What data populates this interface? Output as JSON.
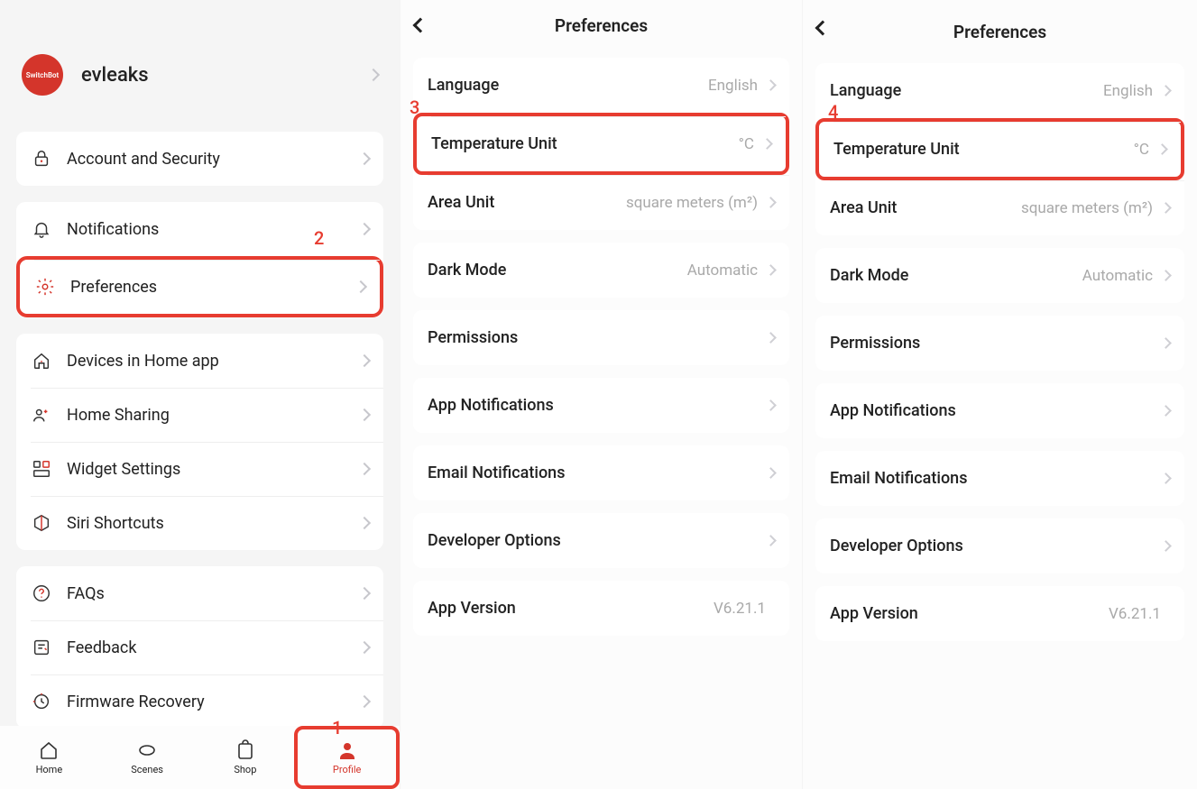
{
  "profile": {
    "brand": "SwitchBot",
    "username": "evleaks",
    "items": [
      {
        "label": "Account and Security"
      },
      {
        "label": "Notifications"
      },
      {
        "label": "Preferences"
      },
      {
        "label": "Devices in Home app"
      },
      {
        "label": "Home Sharing"
      },
      {
        "label": "Widget Settings"
      },
      {
        "label": "Siri Shortcuts"
      },
      {
        "label": "FAQs"
      },
      {
        "label": "Feedback"
      },
      {
        "label": "Firmware Recovery"
      }
    ],
    "tabs": [
      {
        "label": "Home"
      },
      {
        "label": "Scenes"
      },
      {
        "label": "Shop"
      },
      {
        "label": "Profile"
      }
    ]
  },
  "prefs": {
    "title": "Preferences",
    "rows": [
      {
        "label": "Language",
        "value": "English",
        "chevron": true
      },
      {
        "label": "Temperature Unit",
        "value": "°C",
        "chevron": true
      },
      {
        "label": "Area Unit",
        "value": "square meters (m²)",
        "chevron": true
      },
      {
        "label": "Dark Mode",
        "value": "Automatic",
        "chevron": true
      },
      {
        "label": "Permissions",
        "value": "",
        "chevron": true
      },
      {
        "label": "App Notifications",
        "value": "",
        "chevron": true
      },
      {
        "label": "Email Notifications",
        "value": "",
        "chevron": true
      },
      {
        "label": "Developer Options",
        "value": "",
        "chevron": true
      },
      {
        "label": "App Version",
        "value": "V6.21.1",
        "chevron": false
      }
    ]
  },
  "annotations": {
    "n1": "1",
    "n2": "2",
    "n3": "3",
    "n4": "4"
  }
}
